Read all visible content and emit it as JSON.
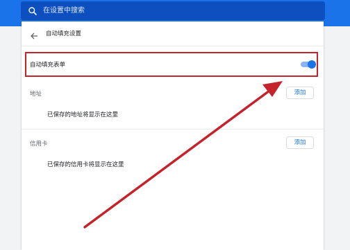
{
  "search": {
    "placeholder": "在设置中搜索",
    "icon": "search-icon"
  },
  "header": {
    "title": "自动填充设置",
    "back_icon": "arrow-left-icon"
  },
  "autofill": {
    "label": "自动填充表单",
    "enabled": true
  },
  "addresses": {
    "label": "地址",
    "add_label": "添加",
    "empty_text": "已保存的地址将显示在这里"
  },
  "credit_cards": {
    "label": "信用卡",
    "add_label": "添加",
    "empty_text": "已保存的信用卡将显示在这里"
  },
  "colors": {
    "accent": "#1a73e8",
    "annotation": "#c4232b"
  }
}
